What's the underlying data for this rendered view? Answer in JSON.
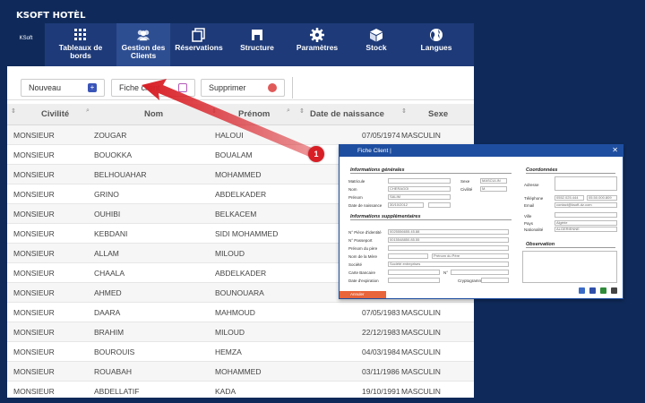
{
  "app": {
    "title": "KSOFT HOTÈL",
    "logo_text": "KSoft"
  },
  "nav": [
    {
      "label": "Tableaux de bords",
      "icon": "dashboard-icon"
    },
    {
      "label": "Gestion des Clients",
      "icon": "users-icon",
      "active": true
    },
    {
      "label": "Réservations",
      "icon": "reservations-icon"
    },
    {
      "label": "Structure",
      "icon": "structure-icon"
    },
    {
      "label": "Paramètres",
      "icon": "gear-icon"
    },
    {
      "label": "Stock",
      "icon": "box-icon"
    },
    {
      "label": "Langues",
      "icon": "globe-icon"
    }
  ],
  "toolbar": {
    "nouveau": "Nouveau",
    "fiche_client": "Fiche client",
    "supprimer": "Supprimer"
  },
  "grid": {
    "columns": [
      "Civilité",
      "Nom",
      "Prénom",
      "Date de naissance",
      "Sexe"
    ],
    "rows": [
      [
        "MONSIEUR",
        "ZOUGAR",
        "HALOUI",
        "07/05/1974",
        "MASCULIN"
      ],
      [
        "MONSIEUR",
        "BOUOKKA",
        "BOUALAM",
        "",
        ""
      ],
      [
        "MONSIEUR",
        "BELHOUAHAR",
        "MOHAMMED",
        "",
        ""
      ],
      [
        "MONSIEUR",
        "GRINO",
        "ABDELKADER",
        "",
        ""
      ],
      [
        "MONSIEUR",
        "OUHIBI",
        "BELKACEM",
        "",
        ""
      ],
      [
        "MONSIEUR",
        "KEBDANI",
        "SIDI MOHAMMED",
        "",
        ""
      ],
      [
        "MONSIEUR",
        "ALLAM",
        "MILOUD",
        "",
        ""
      ],
      [
        "MONSIEUR",
        "CHAALA",
        "ABDELKADER",
        "",
        ""
      ],
      [
        "MONSIEUR",
        "AHMED",
        "BOUNOUARA",
        "",
        ""
      ],
      [
        "MONSIEUR",
        "DAARA",
        "MAHMOUD",
        "07/05/1983",
        "MASCULIN"
      ],
      [
        "MONSIEUR",
        "BRAHIM",
        "MILOUD",
        "22/12/1983",
        "MASCULIN"
      ],
      [
        "MONSIEUR",
        "BOUROUIS",
        "HEMZA",
        "04/03/1984",
        "MASCULIN"
      ],
      [
        "MONSIEUR",
        "ROUABAH",
        "MOHAMMED",
        "03/11/1986",
        "MASCULIN"
      ],
      [
        "MONSIEUR",
        "ABDELLATIF",
        "KADA",
        "19/10/1991",
        "MASCULIN"
      ]
    ]
  },
  "callout": {
    "number": "1"
  },
  "dialog": {
    "title": "Fiche Client |",
    "general_section": "Informations générales",
    "supp_section": "Informations supplémentaires",
    "coord_section": "Coordonnées",
    "obs_section": "Observation",
    "labels": {
      "matricule": "Matricule",
      "nom": "Nom",
      "prenom": "Prénom",
      "date_naissance": "Date de naissance",
      "sexe": "Sexe",
      "civilite": "Civilité",
      "piece": "N° Pièce d'identité",
      "passeport": "N° Passeport",
      "prenom_pere": "Prénom du père",
      "nom_mere": "Nom de la Mère",
      "societe": "Société",
      "carte": "Carte Bancaire",
      "expiration": "Date d'expiration",
      "adresse": "Adresse",
      "telephone": "Téléphone",
      "email": "Email",
      "ville": "Ville",
      "pays": "Pays",
      "nationalite": "Nationalité",
      "num": "N°",
      "cryptogramme": "Cryptogramme"
    },
    "values": {
      "nom": "CHERAGOI",
      "prenom": "SALIM",
      "date_naissance": "30/10/2012",
      "sexe": "MASCULIN",
      "civilite": "M.",
      "piece": "0025556655.45.88",
      "passeport": "0015548850.85.55",
      "nom_mere": "Prénom du Père",
      "societe": "Société entreprises",
      "telephone": "0552.025.444",
      "telephone2": "05.50.000.809",
      "email": "contact@ksoft-dz.com",
      "pays": "Algérie",
      "nationalite": "ALGERIENNE"
    },
    "annuler": "Annuler"
  },
  "colors": {
    "navy": "#0f2a5a",
    "nav": "#1e3a78",
    "arrow": "#d81f26",
    "dialog": "#1e4ea0"
  }
}
